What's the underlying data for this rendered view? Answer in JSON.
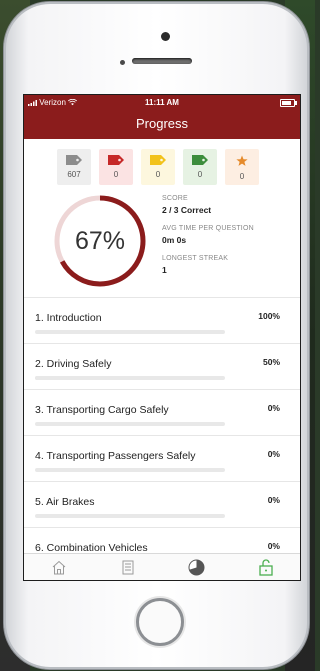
{
  "status_bar": {
    "carrier": "Verizon",
    "time": "11:11 AM"
  },
  "header": {
    "title": "Progress"
  },
  "badges": [
    {
      "count": "607",
      "color": "#8c8c8c",
      "bg": "#eeeeee",
      "icon": "tag-icon"
    },
    {
      "count": "0",
      "color": "#c62828",
      "bg": "#fbe3e3",
      "icon": "tag-icon"
    },
    {
      "count": "0",
      "color": "#f2c21a",
      "bg": "#fdf7de",
      "icon": "tag-icon"
    },
    {
      "count": "0",
      "color": "#3c8d3c",
      "bg": "#e6f2e3",
      "icon": "tag-icon"
    },
    {
      "count": "0",
      "color": "#e58a2b",
      "bg": "#fdeee2",
      "icon": "star-icon"
    }
  ],
  "score_ring": {
    "percent_text": "67%",
    "fraction": 0.67
  },
  "stats": {
    "score_label": "SCORE",
    "score_value": "2 / 3 Correct",
    "avg_label": "AVG TIME PER QUESTION",
    "avg_value": "0m 0s",
    "streak_label": "LONGEST STREAK",
    "streak_value": "1"
  },
  "chapters": [
    {
      "title": "1. Introduction",
      "percent": "100%"
    },
    {
      "title": "2. Driving Safely",
      "percent": "50%"
    },
    {
      "title": "3. Transporting Cargo Safely",
      "percent": "0%"
    },
    {
      "title": "4. Transporting Passengers Safely",
      "percent": "0%"
    },
    {
      "title": "5. Air Brakes",
      "percent": "0%"
    },
    {
      "title": "6. Combination Vehicles",
      "percent": "0%"
    }
  ],
  "colors": {
    "brand": "#8b1c1c",
    "active_tab": "#4caf50",
    "ring_track": "#eed6d6"
  },
  "tabs": [
    {
      "icon": "home-icon"
    },
    {
      "icon": "book-icon"
    },
    {
      "icon": "progress-icon"
    },
    {
      "icon": "unlock-icon"
    }
  ]
}
